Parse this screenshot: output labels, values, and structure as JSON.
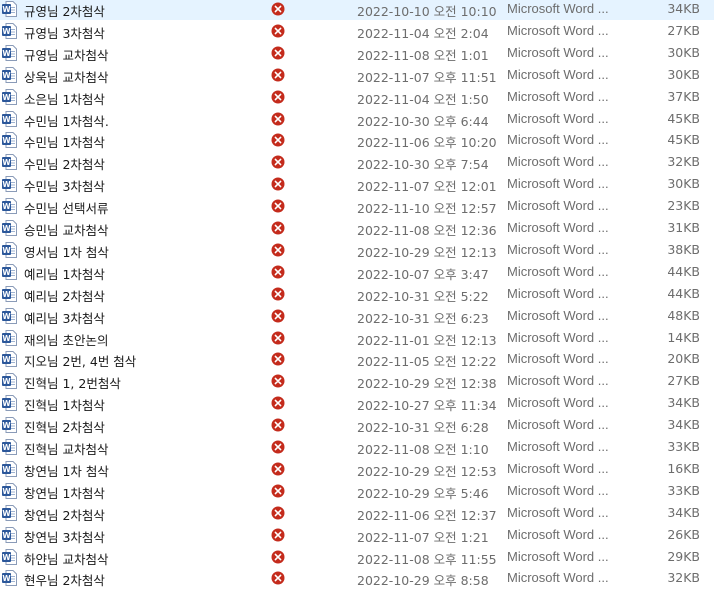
{
  "files": [
    {
      "name": "규영님 2차첨삭",
      "modified": "2022-10-10 오전 10:10",
      "type": "Microsoft Word ...",
      "size": "34KB",
      "icon": "word-doc-icon",
      "status_icon": "sync-error-icon"
    },
    {
      "name": "규영님 3차첨삭",
      "modified": "2022-11-04 오전 2:04",
      "type": "Microsoft Word ...",
      "size": "27KB",
      "icon": "word-doc-icon",
      "status_icon": "sync-error-icon"
    },
    {
      "name": "규영님 교차첨삭",
      "modified": "2022-11-08 오전 1:01",
      "type": "Microsoft Word ...",
      "size": "30KB",
      "icon": "word-doc-icon",
      "status_icon": "sync-error-icon"
    },
    {
      "name": "상욱님 교차첨삭",
      "modified": "2022-11-07 오후 11:51",
      "type": "Microsoft Word ...",
      "size": "30KB",
      "icon": "word-doc-icon",
      "status_icon": "sync-error-icon"
    },
    {
      "name": "소은님 1차첨삭",
      "modified": "2022-11-04 오전 1:50",
      "type": "Microsoft Word ...",
      "size": "37KB",
      "icon": "word-doc-icon",
      "status_icon": "sync-error-icon"
    },
    {
      "name": "수민님 1차첨삭.",
      "modified": "2022-10-30 오후 6:44",
      "type": "Microsoft Word ...",
      "size": "45KB",
      "icon": "word-doc-icon",
      "status_icon": "sync-error-icon"
    },
    {
      "name": "수민님 1차첨삭",
      "modified": "2022-11-06 오후 10:20",
      "type": "Microsoft Word ...",
      "size": "45KB",
      "icon": "word-doc-icon",
      "status_icon": "sync-error-icon"
    },
    {
      "name": "수민님 2차첨삭",
      "modified": "2022-10-30 오후 7:54",
      "type": "Microsoft Word ...",
      "size": "32KB",
      "icon": "word-doc-icon",
      "status_icon": "sync-error-icon"
    },
    {
      "name": "수민님 3차첨삭",
      "modified": "2022-11-07 오전 12:01",
      "type": "Microsoft Word ...",
      "size": "30KB",
      "icon": "word-doc-icon",
      "status_icon": "sync-error-icon"
    },
    {
      "name": "수민님 선택서류",
      "modified": "2022-11-10 오전 12:57",
      "type": "Microsoft Word ...",
      "size": "23KB",
      "icon": "word-doc-icon",
      "status_icon": "sync-error-icon"
    },
    {
      "name": "승민님 교차첨삭",
      "modified": "2022-11-08 오전 12:36",
      "type": "Microsoft Word ...",
      "size": "31KB",
      "icon": "word-doc-icon",
      "status_icon": "sync-error-icon"
    },
    {
      "name": "영서님 1차 첨삭",
      "modified": "2022-10-29 오전 12:13",
      "type": "Microsoft Word ...",
      "size": "38KB",
      "icon": "word-doc-icon",
      "status_icon": "sync-error-icon"
    },
    {
      "name": "예리님 1차첨삭",
      "modified": "2022-10-07 오후 3:47",
      "type": "Microsoft Word ...",
      "size": "44KB",
      "icon": "word-doc-icon",
      "status_icon": "sync-error-icon"
    },
    {
      "name": "예리님 2차첨삭",
      "modified": "2022-10-31 오전 5:22",
      "type": "Microsoft Word ...",
      "size": "44KB",
      "icon": "word-doc-icon",
      "status_icon": "sync-error-icon"
    },
    {
      "name": "예리님 3차첨삭",
      "modified": "2022-10-31 오전 6:23",
      "type": "Microsoft Word ...",
      "size": "48KB",
      "icon": "word-doc-icon",
      "status_icon": "sync-error-icon"
    },
    {
      "name": "재의님 초안논의",
      "modified": "2022-11-01 오전 12:13",
      "type": "Microsoft Word ...",
      "size": "14KB",
      "icon": "word-doc-icon",
      "status_icon": "sync-error-icon"
    },
    {
      "name": "지오님 2번, 4번 첨삭",
      "modified": "2022-11-05 오전 12:22",
      "type": "Microsoft Word ...",
      "size": "20KB",
      "icon": "word-doc-icon",
      "status_icon": "sync-error-icon"
    },
    {
      "name": "진혁님 1, 2번첨삭",
      "modified": "2022-10-29 오전 12:38",
      "type": "Microsoft Word ...",
      "size": "27KB",
      "icon": "word-doc-icon",
      "status_icon": "sync-error-icon"
    },
    {
      "name": "진혁님 1차첨삭",
      "modified": "2022-10-27 오후 11:34",
      "type": "Microsoft Word ...",
      "size": "34KB",
      "icon": "word-doc-icon",
      "status_icon": "sync-error-icon"
    },
    {
      "name": "진혁님 2차첨삭",
      "modified": "2022-10-31 오전 6:28",
      "type": "Microsoft Word ...",
      "size": "34KB",
      "icon": "word-doc-icon",
      "status_icon": "sync-error-icon"
    },
    {
      "name": "진혁님 교차첨삭",
      "modified": "2022-11-08 오전 1:10",
      "type": "Microsoft Word ...",
      "size": "33KB",
      "icon": "word-doc-icon",
      "status_icon": "sync-error-icon"
    },
    {
      "name": "창연님 1차 첨삭",
      "modified": "2022-10-29 오전 12:53",
      "type": "Microsoft Word ...",
      "size": "16KB",
      "icon": "word-doc-icon",
      "status_icon": "sync-error-icon"
    },
    {
      "name": "창연님 1차첨삭",
      "modified": "2022-10-29 오후 5:46",
      "type": "Microsoft Word ...",
      "size": "33KB",
      "icon": "word-doc-icon",
      "status_icon": "sync-error-icon"
    },
    {
      "name": "창연님 2차첨삭",
      "modified": "2022-11-06 오전 12:37",
      "type": "Microsoft Word ...",
      "size": "34KB",
      "icon": "word-doc-icon",
      "status_icon": "sync-error-icon"
    },
    {
      "name": "창연님 3차첨삭",
      "modified": "2022-11-07 오전 1:21",
      "type": "Microsoft Word ...",
      "size": "26KB",
      "icon": "word-doc-icon",
      "status_icon": "sync-error-icon"
    },
    {
      "name": "하얀님 교차첨삭",
      "modified": "2022-11-08 오후 11:55",
      "type": "Microsoft Word ...",
      "size": "29KB",
      "icon": "word-doc-icon",
      "status_icon": "sync-error-icon"
    },
    {
      "name": "현우님 2차첨삭",
      "modified": "2022-10-29 오후 8:58",
      "type": "Microsoft Word ...",
      "size": "32KB",
      "icon": "word-doc-icon",
      "status_icon": "sync-error-icon"
    }
  ],
  "colors": {
    "word_blue": "#2b579a",
    "error_red": "#c42b1c",
    "secondary_text": "#6d6d6d"
  }
}
